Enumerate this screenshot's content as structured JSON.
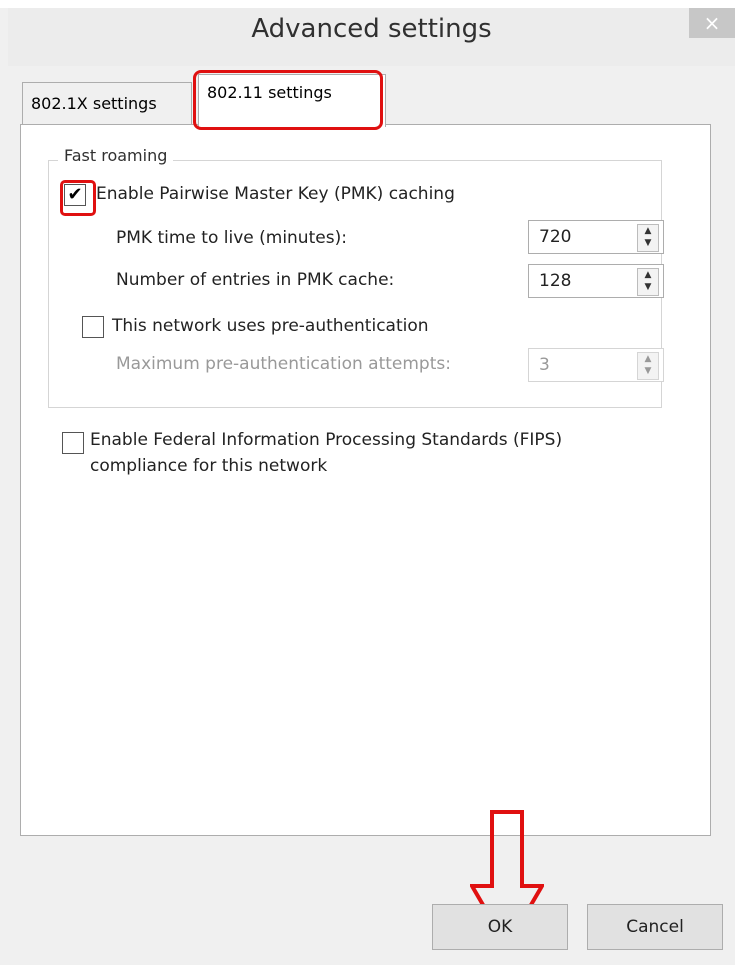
{
  "dialog": {
    "title": "Advanced settings",
    "close_glyph": "×"
  },
  "tabs": [
    {
      "label": "802.1X settings",
      "selected": false
    },
    {
      "label": "802.11 settings",
      "selected": true
    }
  ],
  "fast_roaming": {
    "title": "Fast roaming",
    "pmk_caching_label": "Enable Pairwise Master Key (PMK) caching",
    "pmk_caching_checked": true,
    "pmk_ttl_label": "PMK time to live (minutes):",
    "pmk_ttl_value": "720",
    "pmk_entries_label": "Number of entries in PMK cache:",
    "pmk_entries_value": "128",
    "preauth_label": "This network uses pre-authentication",
    "preauth_checked": false,
    "preauth_attempts_label": "Maximum pre-authentication attempts:",
    "preauth_attempts_value": "3"
  },
  "fips": {
    "line1": "Enable Federal Information Processing Standards (FIPS)",
    "line2": "compliance for this network",
    "checked": false
  },
  "buttons": {
    "ok": "OK",
    "cancel": "Cancel"
  },
  "icons": {
    "close": "close-icon",
    "check": "checkmark-icon",
    "spin": "spin-arrows-icon",
    "annotation_arrow": "down-arrow-icon"
  },
  "colors": {
    "highlight": "#e01010"
  }
}
